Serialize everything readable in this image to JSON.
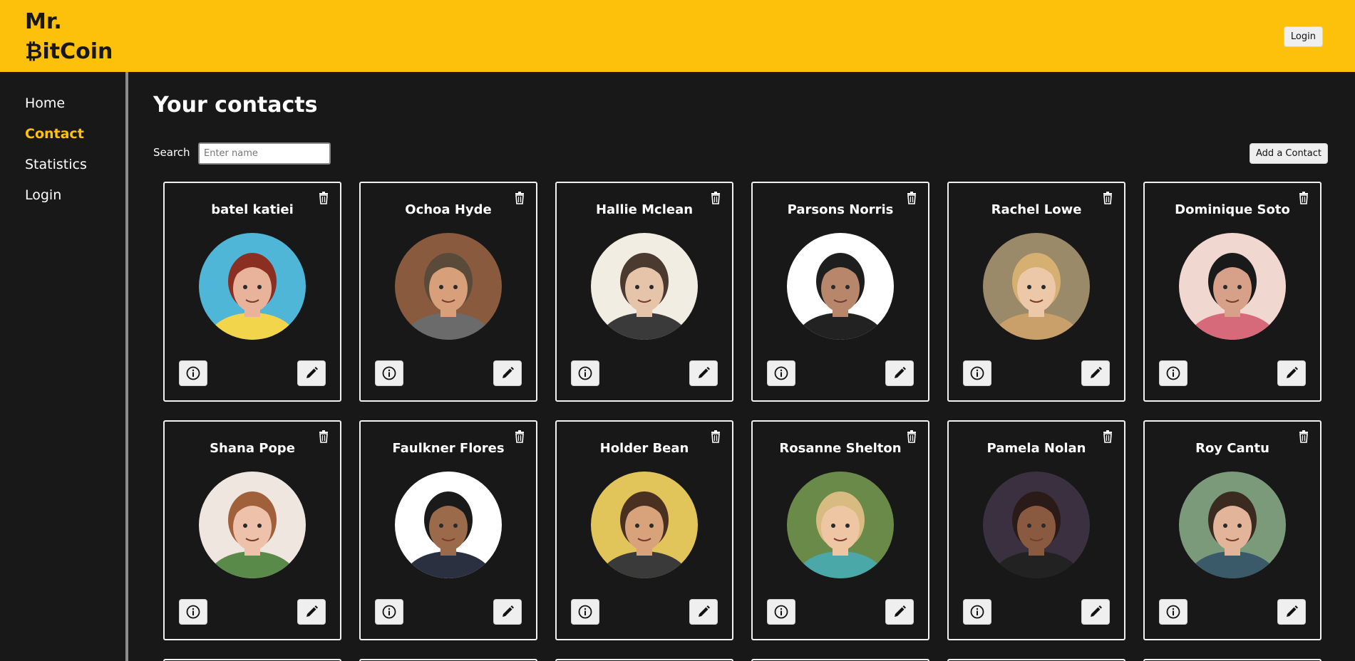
{
  "header": {
    "logo_line1": "Mr.",
    "logo_line2": "₿itCoin",
    "login_label": "Login"
  },
  "sidebar": {
    "items": [
      {
        "label": "Home",
        "active": false
      },
      {
        "label": "Contact",
        "active": true
      },
      {
        "label": "Statistics",
        "active": false
      },
      {
        "label": "Login",
        "active": false
      }
    ]
  },
  "main": {
    "title": "Your contacts",
    "search_label": "Search",
    "search_placeholder": "Enter name",
    "search_value": "",
    "add_label": "Add a Contact"
  },
  "contacts": [
    {
      "name": "batel katiei",
      "bg": "#4fb6d8",
      "hair": "#8a2f22",
      "skin": "#e8b39a",
      "shirt": "#f2d54a"
    },
    {
      "name": "Ochoa Hyde",
      "bg": "#8a5a3e",
      "hair": "#5a4a3a",
      "skin": "#d8a07a",
      "shirt": "#6b6b6b"
    },
    {
      "name": "Hallie Mclean",
      "bg": "#f2ede2",
      "hair": "#4a3a30",
      "skin": "#e6c4aa",
      "shirt": "#3a3a3a"
    },
    {
      "name": "Parsons Norris",
      "bg": "#ffffff",
      "hair": "#1e1e1e",
      "skin": "#b8866a",
      "shirt": "#222222"
    },
    {
      "name": "Rachel Lowe",
      "bg": "#9a8a6a",
      "hair": "#d6b070",
      "skin": "#ecc7a8",
      "shirt": "#c9a06a"
    },
    {
      "name": "Dominique Soto",
      "bg": "#f0d8d0",
      "hair": "#1a1a1a",
      "skin": "#d7a088",
      "shirt": "#d66a7a"
    },
    {
      "name": "Shana Pope",
      "bg": "#efe6e0",
      "hair": "#a0603a",
      "skin": "#eec2aa",
      "shirt": "#5a8a4a"
    },
    {
      "name": "Faulkner Flores",
      "bg": "#ffffff",
      "hair": "#1a1a1a",
      "skin": "#9a6a4a",
      "shirt": "#2a3040"
    },
    {
      "name": "Holder Bean",
      "bg": "#e2c55a",
      "hair": "#4a3020",
      "skin": "#d8a27a",
      "shirt": "#3a3a3a"
    },
    {
      "name": "Rosanne Shelton",
      "bg": "#6a8a4a",
      "hair": "#d8bb80",
      "skin": "#eec6a4",
      "shirt": "#4aa8a8"
    },
    {
      "name": "Pamela Nolan",
      "bg": "#3a3040",
      "hair": "#2a1a18",
      "skin": "#8a5a40",
      "shirt": "#222222"
    },
    {
      "name": "Roy Cantu",
      "bg": "#7a9a7a",
      "hair": "#3a2a20",
      "skin": "#e2b49a",
      "shirt": "#3a5a6a"
    }
  ],
  "partial_cards": 6,
  "colors": {
    "accent": "#fdc10c",
    "background": "#181818",
    "card_border": "#f2f2f2"
  },
  "icons": {
    "delete": "trash-icon",
    "details": "info-icon",
    "edit": "pencil-icon"
  }
}
